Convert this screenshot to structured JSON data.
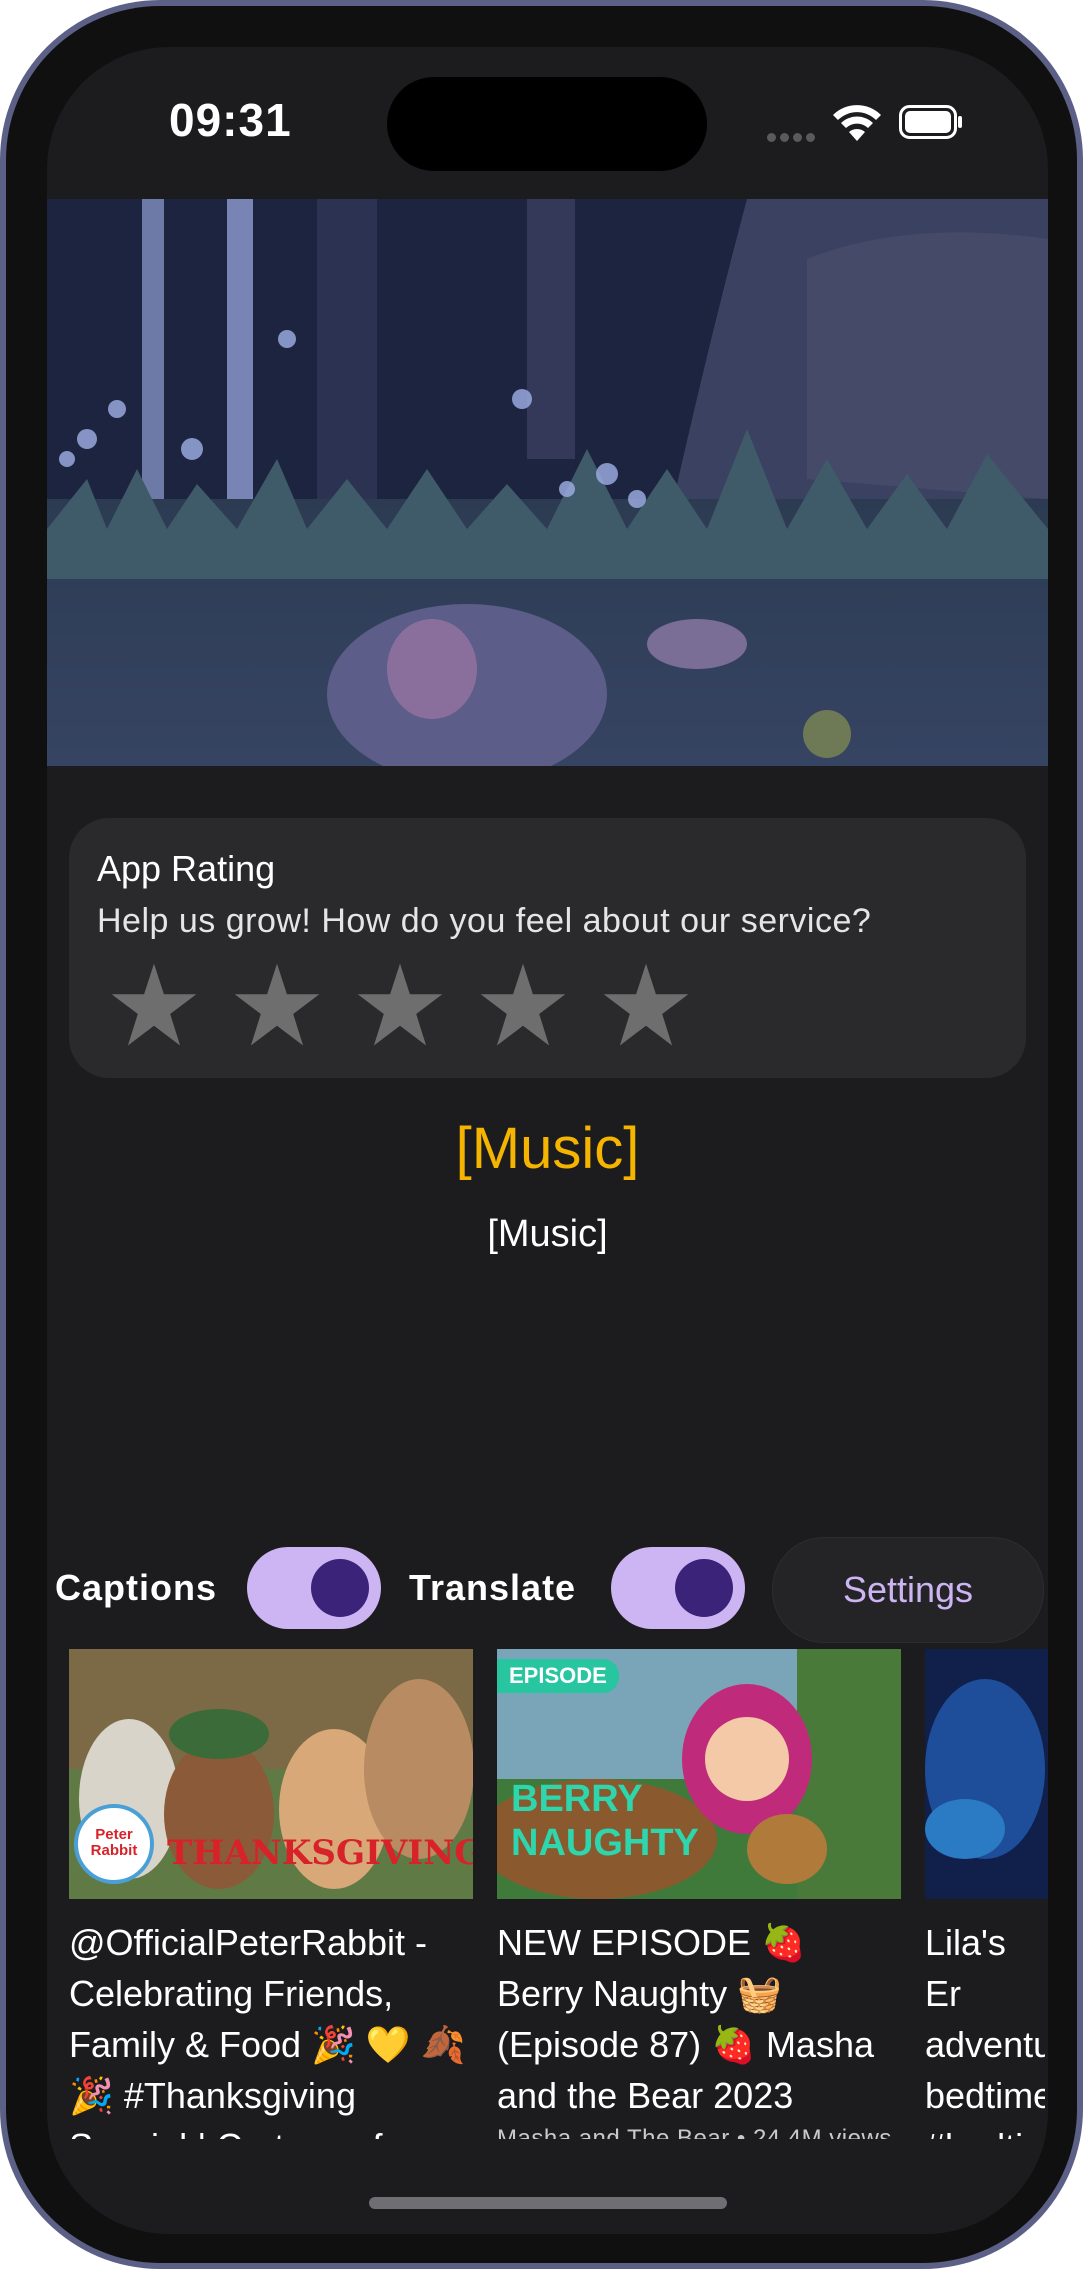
{
  "status_bar": {
    "time": "09:31"
  },
  "rating": {
    "title": "App Rating",
    "subtitle": "Help us grow! How do you feel about our service?",
    "star_count": 5,
    "selected": 0,
    "star_color": "#6e6e6e"
  },
  "captions": {
    "primary": "[Music]",
    "secondary": "[Music]",
    "primary_color": "#f4b400"
  },
  "controls": {
    "captions_label": "Captions",
    "captions_on": true,
    "translate_label": "Translate",
    "translate_on": true,
    "settings_label": "Settings",
    "accent": "#cdb5f4"
  },
  "videos": [
    {
      "title": "@OfficialPeterRabbit - Celebrating Friends, Family & Food 🎉 💛 🍂 🎉 #Thanksgiving Special | Cartoons for",
      "thumb_badge": "Peter Rabbit",
      "thumb_text": "THANKSGIVING"
    },
    {
      "title": "NEW EPISODE 🍓 Berry Naughty 🧺 (Episode 87) 🍓 Masha and the Bear 2023",
      "meta": "Masha and The Bear • 24.4M views",
      "thumb_badge": "EPISODE",
      "thumb_text_1": "BERRY",
      "thumb_text_2": "NAUGHTY"
    },
    {
      "title": "Lila's Er adventu bedtime #bedtin #adven"
    }
  ]
}
